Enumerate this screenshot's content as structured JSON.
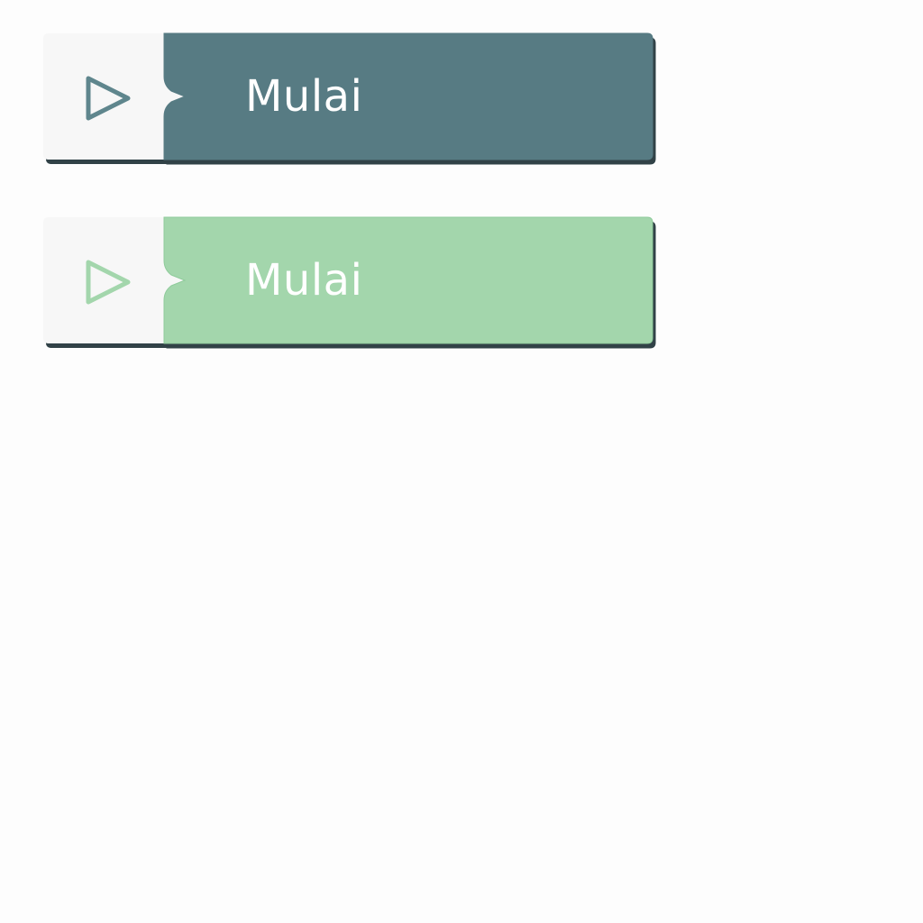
{
  "buttons": [
    {
      "id": "primary",
      "label": "Mulai",
      "icon": "play-icon",
      "state": "enabled",
      "fill_color": "#577b83",
      "icon_color": "#5f868d",
      "outline_color": "#577b83"
    },
    {
      "id": "disabled",
      "label": "Mulai",
      "icon": "play-icon",
      "state": "disabled",
      "fill_color": "#a3d6ac",
      "icon_color": "#a3d6ac",
      "outline_color": "#8fcb9b"
    }
  ]
}
